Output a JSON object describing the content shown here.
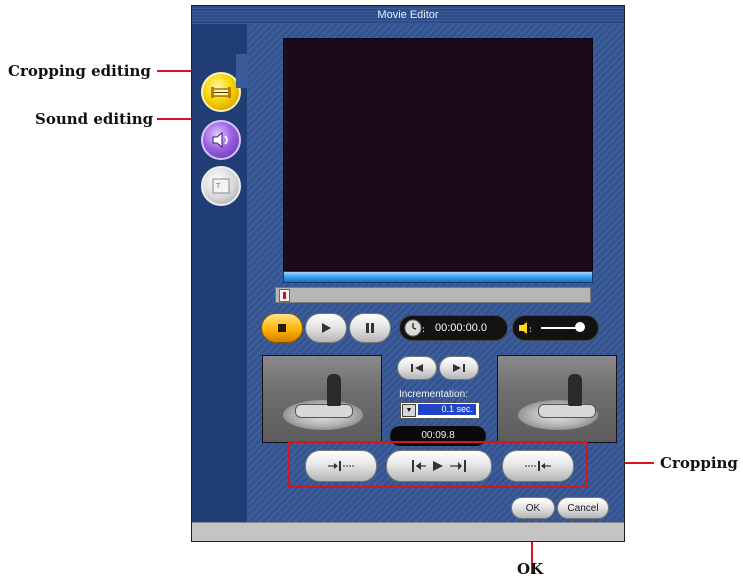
{
  "window": {
    "title": "Movie Editor"
  },
  "sidebar": {
    "cropping_icon": "cropping-icon",
    "sound_icon": "speaker-icon",
    "title_icon": "title-icon"
  },
  "player": {
    "time": "00:00:00.0",
    "stop_icon": "stop-icon",
    "play_icon": "play-icon",
    "pause_icon": "pause-icon",
    "clock_icon": "clock-icon",
    "volume_icon": "volume-icon"
  },
  "cropping": {
    "incrementation_label": "Incrementation:",
    "incrementation_value": "0.1 sec.",
    "position": "00:09.8"
  },
  "buttons": {
    "ok": "OK",
    "cancel": "Cancel"
  },
  "callouts": {
    "cropping_editing": "Cropping editing",
    "sound_editing": "Sound editing",
    "cropping": "Cropping",
    "ok": "OK"
  },
  "colors": {
    "accent": "#d9141c",
    "window_bg": "#2c4b86",
    "progress": "#3aa0ea"
  }
}
